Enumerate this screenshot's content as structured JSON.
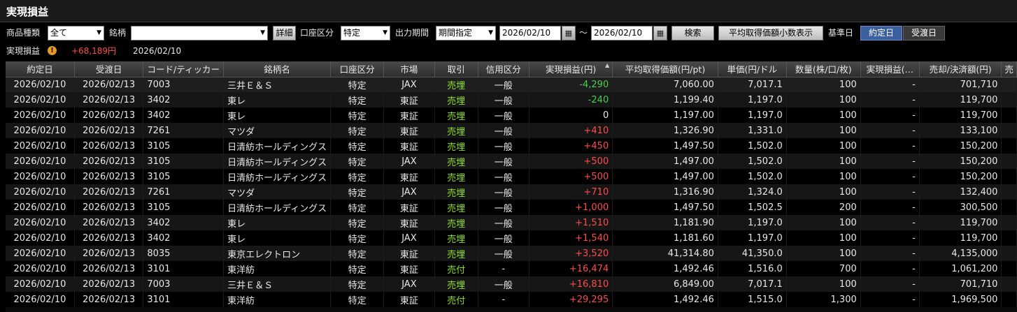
{
  "window": {
    "title": "実現損益"
  },
  "filters": {
    "product_label": "商品種類",
    "product_value": "全て",
    "issue_label": "銘柄",
    "issue_value": "",
    "detail_button": "詳細",
    "account_label": "口座区分",
    "account_value": "特定",
    "period_label": "出力期間",
    "period_value": "期間指定",
    "date_from": "2026/02/10",
    "date_sep": "～",
    "date_to": "2026/02/10",
    "search_button": "検索",
    "decimal_button": "平均取得価額小数表示",
    "base_label": "基準日",
    "base_trade_button": "約定日",
    "base_settle_button": "受渡日"
  },
  "summary": {
    "label": "実現損益",
    "warn_glyph": "!",
    "value": "+68,189円",
    "date": "2026/02/10"
  },
  "colors": {
    "gain": "#ff4b4b",
    "loss": "#4ad04a",
    "sell": "#8fe12a",
    "active_tab": "#3c5f9e"
  },
  "table": {
    "headers": [
      "約定日",
      "受渡日",
      "コード/ティッカー",
      "銘柄名",
      "口座区分",
      "市場",
      "取引",
      "信用区分",
      "実現損益(円)",
      "平均取得価額(円/pt)",
      "単価(円/ドル",
      "数量(株/口/枚)",
      "実現損益(…",
      "売却/決済額(円)",
      "売"
    ],
    "rows": [
      [
        "2026/02/10",
        "2026/02/13",
        "7003",
        "三井Ｅ＆Ｓ",
        "特定",
        "JAX",
        "売埋",
        "一般",
        "-4,290",
        "7,060.00",
        "7,017.1",
        "100",
        "-",
        "701,710",
        ""
      ],
      [
        "2026/02/10",
        "2026/02/13",
        "3402",
        "東レ",
        "特定",
        "東証",
        "売埋",
        "一般",
        "-240",
        "1,199.40",
        "1,197.0",
        "100",
        "-",
        "119,700",
        ""
      ],
      [
        "2026/02/10",
        "2026/02/13",
        "3402",
        "東レ",
        "特定",
        "東証",
        "売埋",
        "一般",
        "0",
        "1,197.00",
        "1,197.0",
        "100",
        "-",
        "119,700",
        ""
      ],
      [
        "2026/02/10",
        "2026/02/13",
        "7261",
        "マツダ",
        "特定",
        "東証",
        "売埋",
        "一般",
        "+410",
        "1,326.90",
        "1,331.0",
        "100",
        "-",
        "133,100",
        ""
      ],
      [
        "2026/02/10",
        "2026/02/13",
        "3105",
        "日清紡ホールディングス",
        "特定",
        "東証",
        "売埋",
        "一般",
        "+450",
        "1,497.50",
        "1,502.0",
        "100",
        "-",
        "150,200",
        ""
      ],
      [
        "2026/02/10",
        "2026/02/13",
        "3105",
        "日清紡ホールディングス",
        "特定",
        "JAX",
        "売埋",
        "一般",
        "+500",
        "1,497.00",
        "1,502.0",
        "100",
        "-",
        "150,200",
        ""
      ],
      [
        "2026/02/10",
        "2026/02/13",
        "3105",
        "日清紡ホールディングス",
        "特定",
        "東証",
        "売埋",
        "一般",
        "+500",
        "1,497.00",
        "1,502.0",
        "100",
        "-",
        "150,200",
        ""
      ],
      [
        "2026/02/10",
        "2026/02/13",
        "7261",
        "マツダ",
        "特定",
        "JAX",
        "売埋",
        "一般",
        "+710",
        "1,316.90",
        "1,324.0",
        "100",
        "-",
        "132,400",
        ""
      ],
      [
        "2026/02/10",
        "2026/02/13",
        "3105",
        "日清紡ホールディングス",
        "特定",
        "東証",
        "売埋",
        "一般",
        "+1,000",
        "1,497.50",
        "1,502.5",
        "200",
        "-",
        "300,500",
        ""
      ],
      [
        "2026/02/10",
        "2026/02/13",
        "3402",
        "東レ",
        "特定",
        "東証",
        "売埋",
        "一般",
        "+1,510",
        "1,181.90",
        "1,197.0",
        "100",
        "-",
        "119,700",
        ""
      ],
      [
        "2026/02/10",
        "2026/02/13",
        "3402",
        "東レ",
        "特定",
        "JAX",
        "売埋",
        "一般",
        "+1,540",
        "1,181.60",
        "1,197.0",
        "100",
        "-",
        "119,700",
        ""
      ],
      [
        "2026/02/10",
        "2026/02/13",
        "8035",
        "東京エレクトロン",
        "特定",
        "東証",
        "売埋",
        "一般",
        "+3,520",
        "41,314.80",
        "41,350.0",
        "100",
        "-",
        "4,135,000",
        ""
      ],
      [
        "2026/02/10",
        "2026/02/13",
        "3101",
        "東洋紡",
        "特定",
        "東証",
        "売付",
        "-",
        "+16,474",
        "1,492.46",
        "1,516.0",
        "700",
        "-",
        "1,061,200",
        ""
      ],
      [
        "2026/02/10",
        "2026/02/13",
        "7003",
        "三井Ｅ＆Ｓ",
        "特定",
        "JAX",
        "売埋",
        "一般",
        "+16,810",
        "6,849.00",
        "7,017.1",
        "100",
        "-",
        "701,710",
        ""
      ],
      [
        "2026/02/10",
        "2026/02/13",
        "3101",
        "東洋紡",
        "特定",
        "東証",
        "売付",
        "-",
        "+29,295",
        "1,492.46",
        "1,515.0",
        "1,300",
        "-",
        "1,969,500",
        ""
      ]
    ]
  }
}
